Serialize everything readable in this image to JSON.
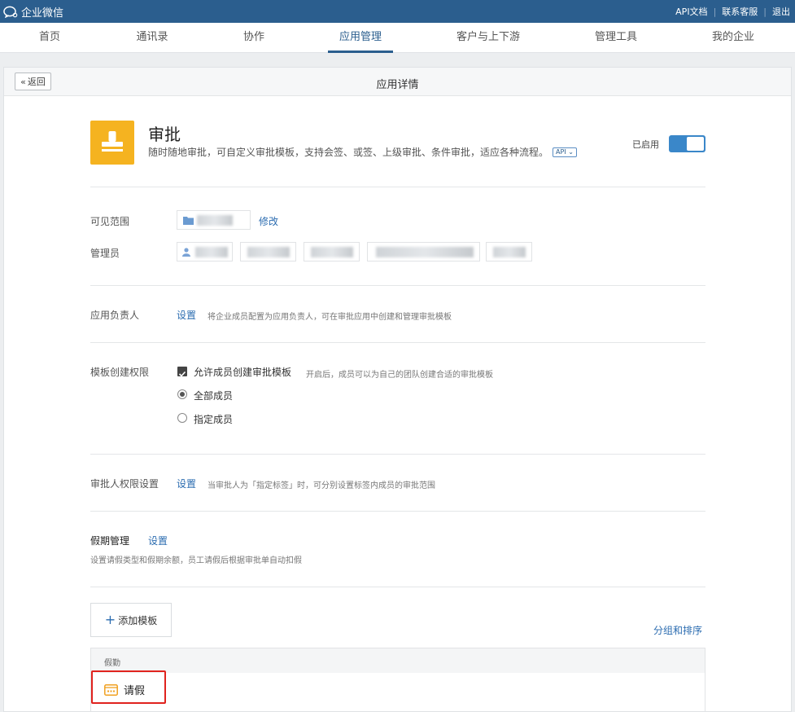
{
  "topbar": {
    "logo_text": "企业微信",
    "links": [
      "API文档",
      "联系客服",
      "退出"
    ]
  },
  "nav": {
    "items": [
      "首页",
      "通讯录",
      "协作",
      "应用管理",
      "客户与上下游",
      "管理工具",
      "我的企业"
    ],
    "active": "应用管理"
  },
  "panel": {
    "back_label": "返回",
    "title": "应用详情"
  },
  "app": {
    "name": "审批",
    "description": "随时随地审批，可自定义审批模板，支持会签、或签、上级审批、条件审批，适应各种流程。",
    "api_tag": "API",
    "status_label": "已启用",
    "enabled": true,
    "icon": "stamp-icon",
    "icon_color": "#f5b320"
  },
  "visible_scope": {
    "label": "可见范围",
    "edit_link": "修改"
  },
  "admins": {
    "label": "管理员"
  },
  "app_owner": {
    "label": "应用负责人",
    "set_link": "设置",
    "hint": "将企业成员配置为应用负责人，可在审批应用中创建和管理审批模板"
  },
  "template_perm": {
    "label": "模板创建权限",
    "checkbox_label": "允许成员创建审批模板",
    "checkbox_checked": true,
    "checkbox_hint": "开启后，成员可以为自己的团队创建合适的审批模板",
    "options": [
      "全部成员",
      "指定成员"
    ],
    "selected": "全部成员"
  },
  "approver_perm": {
    "label": "审批人权限设置",
    "set_link": "设置",
    "hint": "当审批人为「指定标签」时，可分别设置标签内成员的审批范围"
  },
  "leave": {
    "title": "假期管理",
    "set_link": "设置",
    "hint": "设置请假类型和假期余额，员工请假后根据审批单自动扣假"
  },
  "templates": {
    "add_label": "添加模板",
    "group_sort_link": "分组和排序",
    "category": "假勤",
    "items": [
      {
        "label": "请假",
        "icon": "calendar-icon"
      }
    ]
  },
  "colors": {
    "topbar": "#2b5e8e",
    "accent": "#2b6cb0",
    "highlight": "#e0231e"
  }
}
